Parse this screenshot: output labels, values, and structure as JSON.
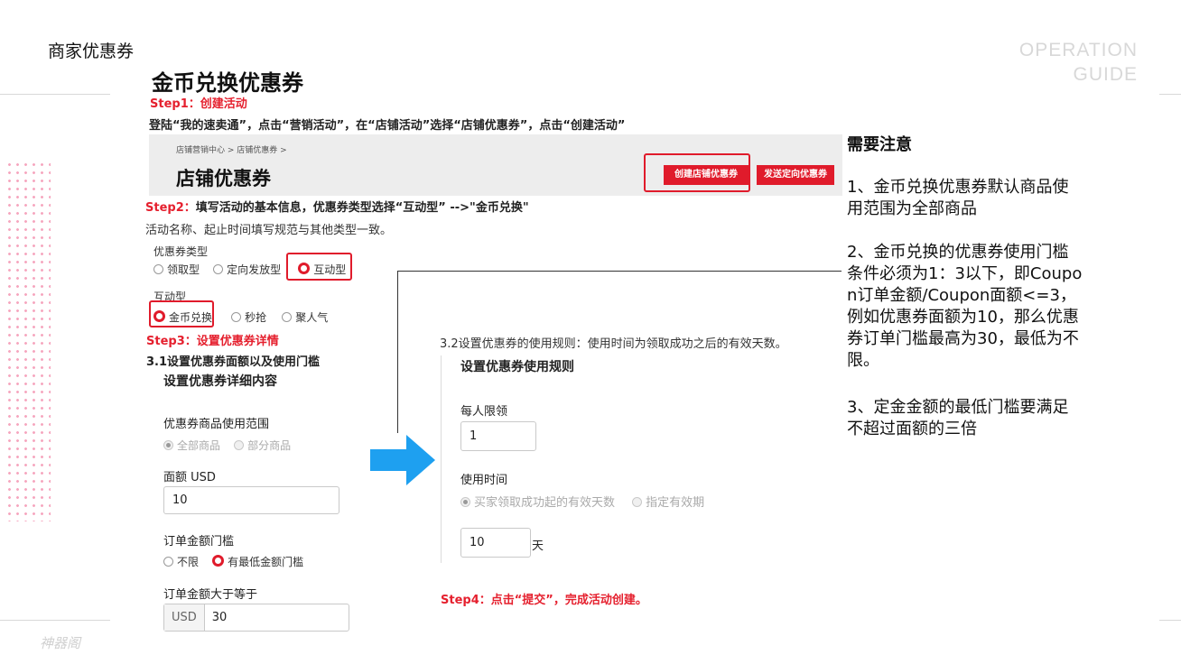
{
  "slide": {
    "title": "商家优惠券",
    "guide_line1": "OPERATION",
    "guide_line2": "GUIDE",
    "watermark": "神器阁",
    "doc_title": "金币兑换优惠券"
  },
  "step1": {
    "heading": "Step1：创建活动",
    "instruction": "登陆“我的速卖通”，点击“营销活动”，在“店铺活动”选择“店铺优惠券”，点击“创建活动”",
    "breadcrumb": "店铺营销中心  >  店铺优惠券  >",
    "banner_title": "店铺优惠券",
    "create_button": "创建店铺优惠券",
    "targeted_button": "发送定向优惠券"
  },
  "step2": {
    "heading": "Step2：",
    "instruction": "填写活动的基本信息，优惠券类型选择“互动型” -->\"金币兑换\"",
    "subtext": "活动名称、起止时间填写规范与其他类型一致。",
    "coupon_type_label": "优惠券类型",
    "coupon_types": [
      "领取型",
      "定向发放型",
      "互动型"
    ],
    "interactive_label": "互动型",
    "interactive_types": [
      "金币兑换",
      "秒抢",
      "聚人气"
    ]
  },
  "step3": {
    "heading": "Step3：设置优惠券详情",
    "sub_heading": "3.1设置优惠券面额以及使用门槛",
    "panel_title": "设置优惠券详细内容",
    "scope_label": "优惠券商品使用范围",
    "scope_options": [
      "全部商品",
      "部分商品"
    ],
    "amount_label": "面额 USD",
    "amount_value": "10",
    "threshold_label": "订单金额门槛",
    "threshold_options": [
      "不限",
      "有最低金额门槛"
    ],
    "min_order_label": "订单金额大于等于",
    "currency": "USD",
    "min_order_value": "30"
  },
  "step3_2": {
    "heading": "3.2设置优惠券的使用规则：使用时间为领取成功之后的有效天数。",
    "panel_title": "设置优惠券使用规则",
    "limit_label": "每人限领",
    "limit_value": "1",
    "time_label": "使用时间",
    "time_options": [
      "买家领取成功起的有效天数",
      "指定有效期"
    ],
    "days_value": "10",
    "days_unit": "天"
  },
  "step4": {
    "heading": "Step4：点击“提交”，完成活动创建。"
  },
  "notes": {
    "title": "需要注意",
    "items": [
      "1、金币兑换优惠券默认商品使用范围为全部商品",
      "2、金币兑换的优惠券使用门槛条件必须为1：3以下，即Coupon订单金额/Coupon面额<=3，例如优惠券面额为10，那么优惠券订单门槛最高为30，最低为不限。",
      "3、定金金额的最低门槛要满足不超过面额的三倍"
    ]
  },
  "colors": {
    "accent_red": "#e01b2b",
    "arrow_blue": "#1ea0f0",
    "dots_pink": "#f6a7bf"
  }
}
